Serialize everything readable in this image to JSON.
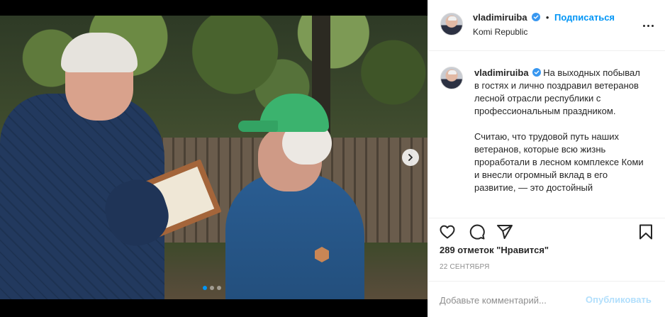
{
  "header": {
    "username": "vladimiruiba",
    "separator": "•",
    "follow_label": "Подписаться",
    "location": "Komi Republic"
  },
  "caption": {
    "username": "vladimiruiba",
    "paragraph1": "На выходных побывал в гостях и лично поздравил ветеранов лесной отрасли республики с профессиональным праздником.",
    "paragraph2": "Считаю, что трудовой путь наших ветеранов, которые всю жизнь проработали в лесном комплексе Коми и внесли огромный вклад в его развитие, — это достойный"
  },
  "likes_text": "289 отметок \"Нравится\"",
  "date_text": "22 сентября",
  "add_comment": {
    "placeholder": "Добавьте комментарий...",
    "publish_label": "Опубликовать"
  },
  "carousel": {
    "count": 3,
    "active_index": 0
  },
  "colors": {
    "accent": "#0095f6",
    "publish_disabled": "#b2dffc",
    "verified": "#3897f0"
  },
  "icons": [
    "verified-icon",
    "more-options-icon",
    "heart-icon",
    "comment-icon",
    "share-icon",
    "bookmark-icon",
    "chevron-right-icon"
  ]
}
